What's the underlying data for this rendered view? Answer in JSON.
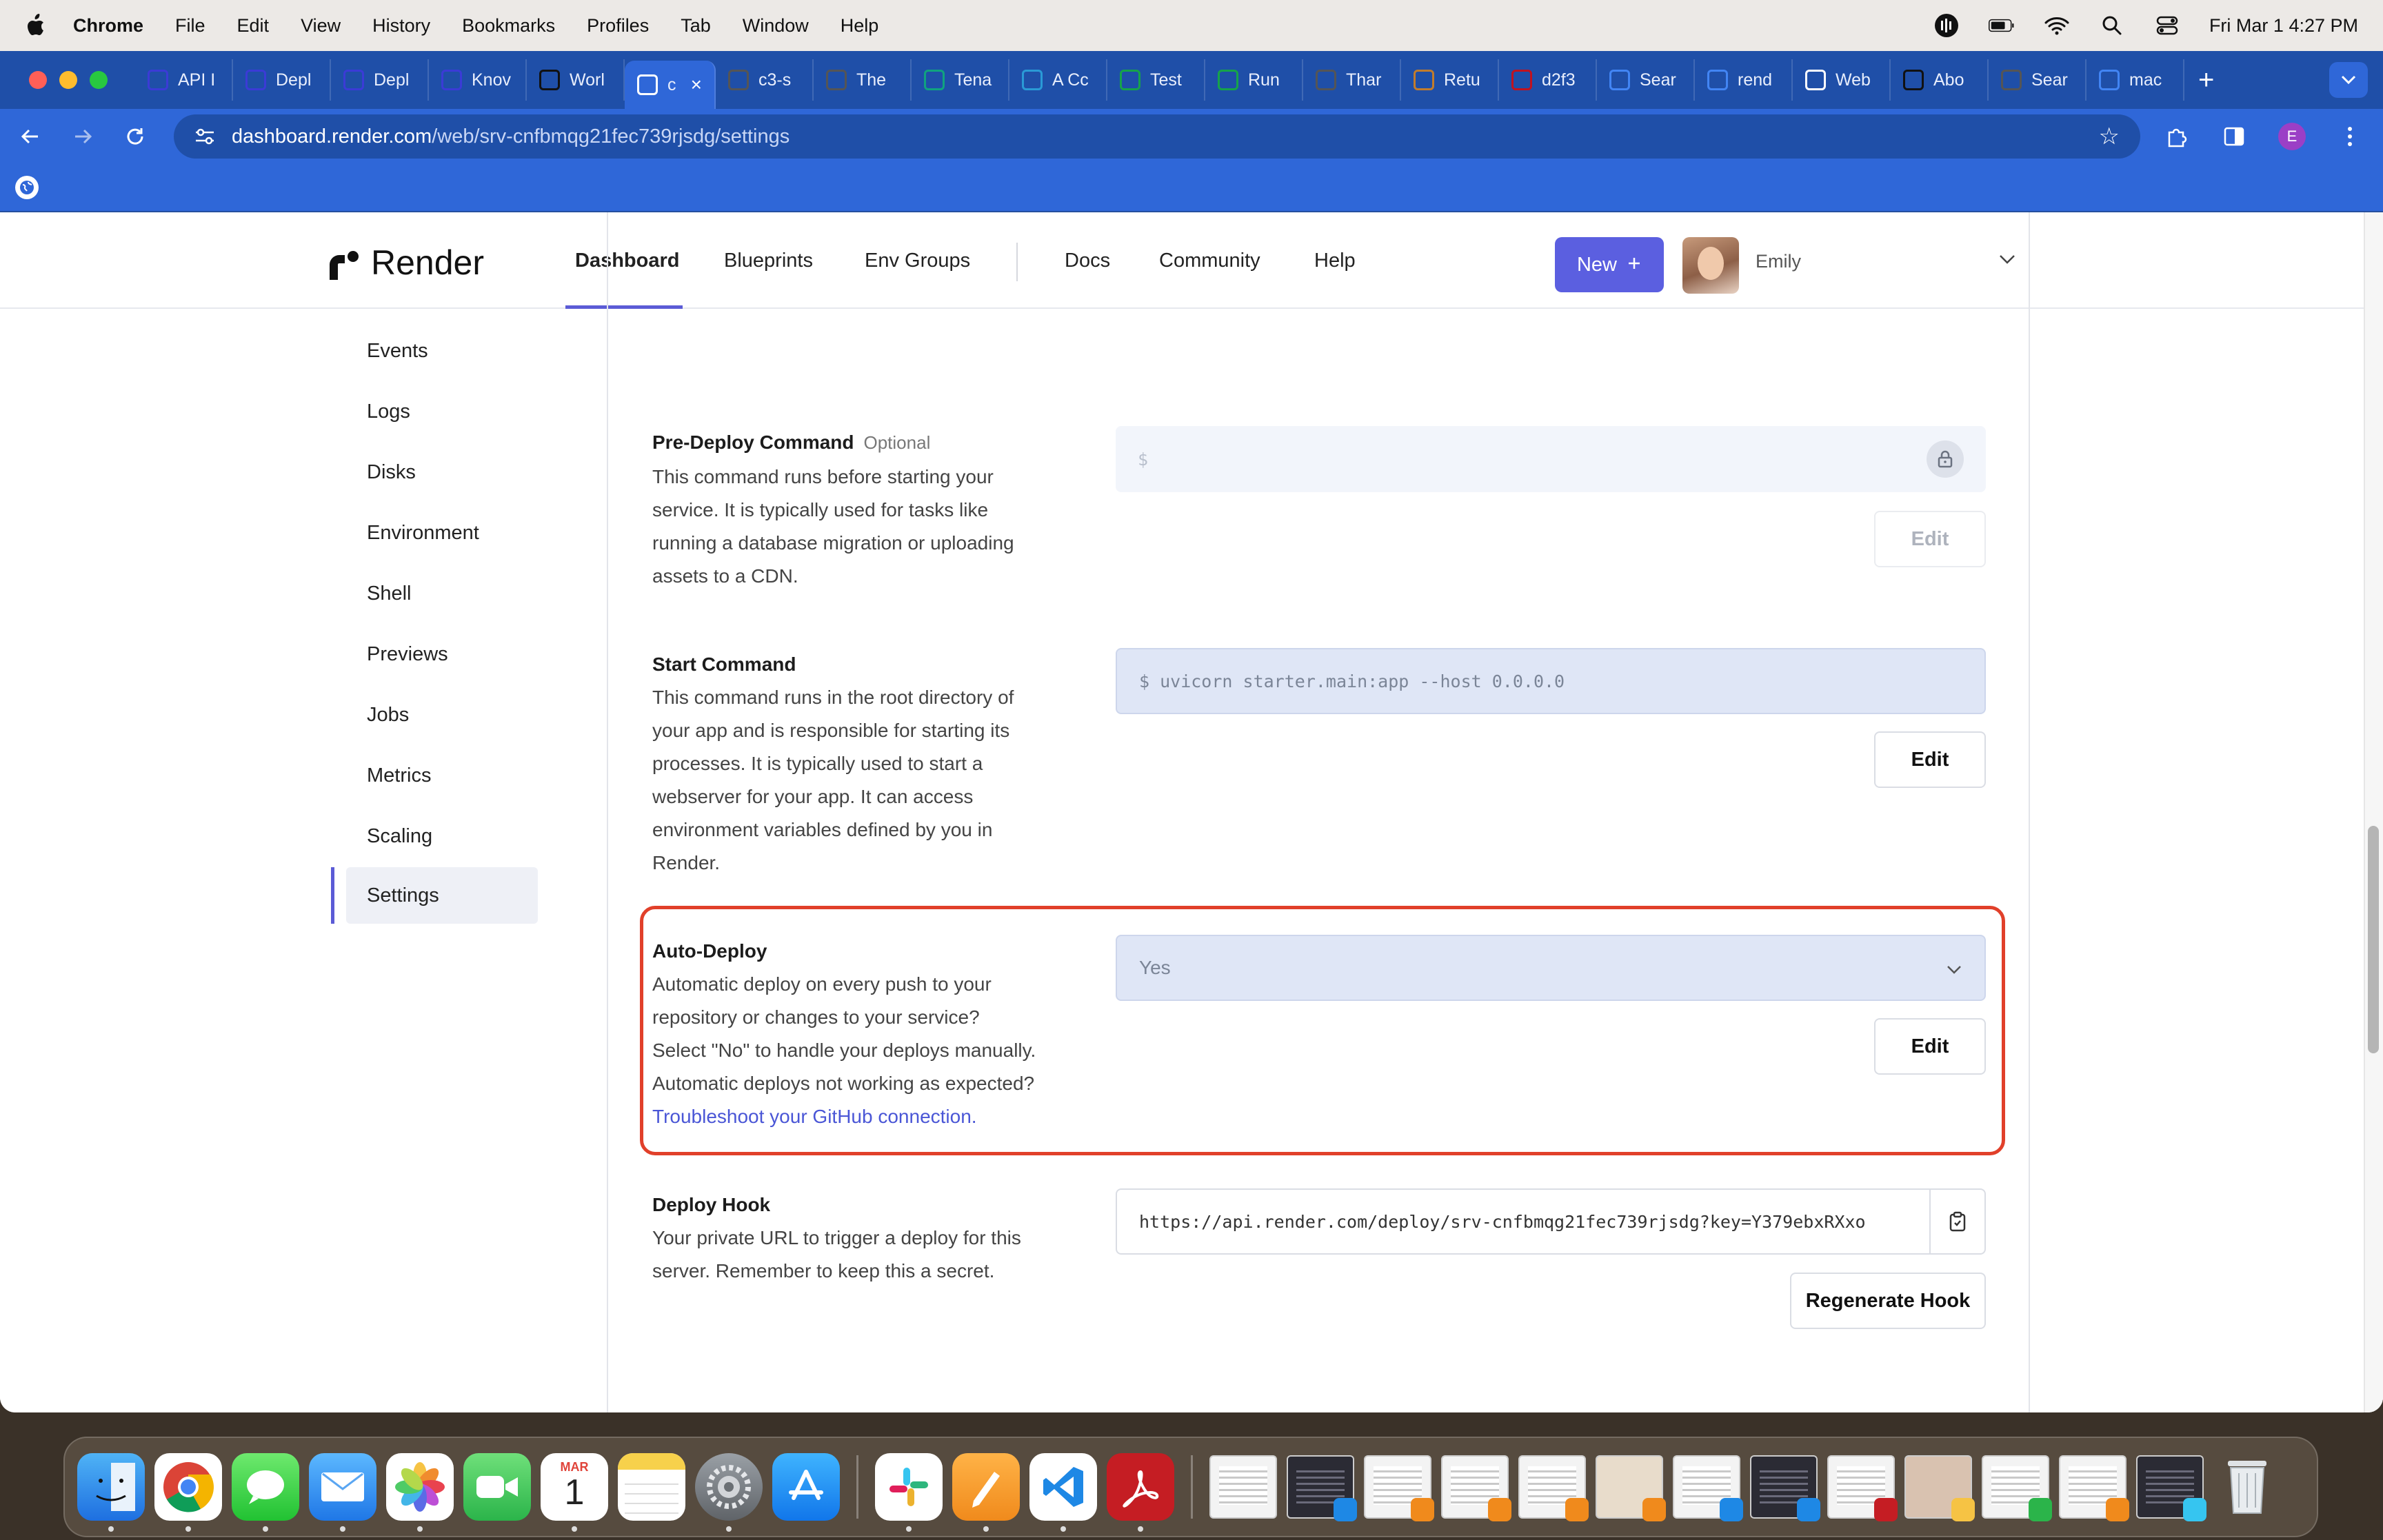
{
  "menubar": {
    "app_name": "Chrome",
    "items": [
      "File",
      "Edit",
      "View",
      "History",
      "Bookmarks",
      "Profiles",
      "Tab",
      "Window",
      "Help"
    ],
    "datetime": "Fri Mar 1  4:27 PM"
  },
  "tabs": [
    {
      "label": "API I",
      "icon": "api-icon",
      "color": "#3b3bd6"
    },
    {
      "label": "Depl",
      "icon": "deploy-icon",
      "color": "#3b3bd6"
    },
    {
      "label": "Depl",
      "icon": "deploy-icon",
      "color": "#3b3bd6"
    },
    {
      "label": "Knov",
      "icon": "knowledge-icon",
      "color": "#3b3bd6"
    },
    {
      "label": "Worl",
      "icon": "github-icon",
      "color": "#111111"
    },
    {
      "label": "c",
      "icon": "render-icon",
      "color": "#ffffff",
      "active": true
    },
    {
      "label": "c3-s",
      "icon": "globe-icon",
      "color": "#555555"
    },
    {
      "label": "The",
      "icon": "arrow-icon",
      "color": "#555555"
    },
    {
      "label": "Tena",
      "icon": "openai-icon",
      "color": "#10a37f"
    },
    {
      "label": "A Cc",
      "icon": "cube-icon",
      "color": "#2a9ad6"
    },
    {
      "label": "Test",
      "icon": "leaf-icon",
      "color": "#16a34a"
    },
    {
      "label": "Run",
      "icon": "leaf-icon",
      "color": "#16a34a"
    },
    {
      "label": "Thar",
      "icon": "globe-icon",
      "color": "#555555"
    },
    {
      "label": "Retu",
      "icon": "image-icon",
      "color": "#c27c2c"
    },
    {
      "label": "d2f3",
      "icon": "pdf-icon",
      "color": "#c1121f"
    },
    {
      "label": "Sear",
      "icon": "google-icon",
      "color": "#4285f4"
    },
    {
      "label": "rend",
      "icon": "google-icon",
      "color": "#4285f4"
    },
    {
      "label": "Web",
      "icon": "render-icon",
      "color": "#ffffff"
    },
    {
      "label": "Abo",
      "icon": "github-icon",
      "color": "#111111"
    },
    {
      "label": "Sear",
      "icon": "globe-icon",
      "color": "#555555"
    },
    {
      "label": "mac",
      "icon": "google-icon",
      "color": "#4285f4"
    }
  ],
  "omnibox": {
    "host": "dashboard.render.com",
    "path": "/web/srv-cnfbmqg21fec739rjsdg/settings"
  },
  "profile_initial": "E",
  "header": {
    "logo_text": "Render",
    "nav": [
      "Dashboard",
      "Blueprints",
      "Env Groups",
      "Docs",
      "Community",
      "Help"
    ],
    "active_nav": "Dashboard",
    "new_button": "New",
    "user_name": "Emily"
  },
  "sidebar": {
    "items": [
      "Events",
      "Logs",
      "Disks",
      "Environment",
      "Shell",
      "Previews",
      "Jobs",
      "Metrics",
      "Scaling",
      "Settings"
    ],
    "active": "Settings"
  },
  "settings": {
    "pre_deploy": {
      "title": "Pre-Deploy Command",
      "optional": "Optional",
      "desc_lines": [
        "This command runs before starting your",
        "service. It is typically used for tasks like",
        "running a database migration or uploading",
        "assets to a CDN."
      ],
      "value": "$",
      "button": "Edit"
    },
    "start_command": {
      "title": "Start Command",
      "desc_lines": [
        "This command runs in the root directory of",
        "your app and is responsible for starting its",
        "processes. It is typically used to start a",
        "webserver for your app. It can access",
        "environment variables defined by you in",
        "Render."
      ],
      "value": "$ uvicorn starter.main:app --host 0.0.0.0",
      "button": "Edit"
    },
    "auto_deploy": {
      "title": "Auto-Deploy",
      "desc_lines": [
        "Automatic deploy on every push to your",
        "repository or changes to your service?",
        "Select \"No\" to handle your deploys manually.",
        "Automatic deploys not working as expected?"
      ],
      "link": "Troubleshoot your GitHub connection.",
      "value": "Yes",
      "button": "Edit"
    },
    "deploy_hook": {
      "title": "Deploy Hook",
      "desc_lines": [
        "Your private URL to trigger a deploy for this",
        "server. Remember to keep this a secret."
      ],
      "value": "https://api.render.com/deploy/srv-cnfbmqg21fec739rjsdg?key=Y379ebxRXxo",
      "button": "Regenerate Hook"
    }
  },
  "colors": {
    "accent": "#5b5fe0",
    "highlight": "#e1402a",
    "chrome_tabstrip": "#1f4fa8",
    "chrome_toolbar": "#2f67d8"
  },
  "dock": {
    "calendar_month": "MAR",
    "calendar_day": "1"
  }
}
